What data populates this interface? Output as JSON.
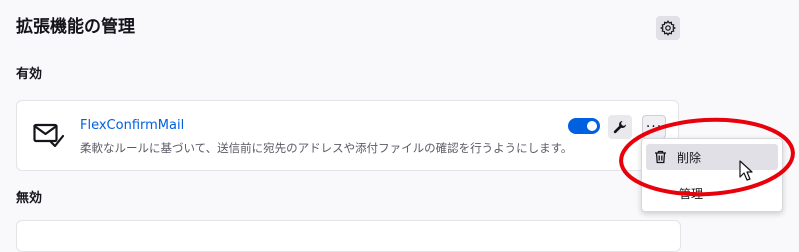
{
  "header": {
    "title": "拡張機能の管理",
    "settings_icon": "gear-icon"
  },
  "sections": {
    "enabled_heading": "有効",
    "disabled_heading": "無効"
  },
  "addon": {
    "name": "FlexConfirmMail",
    "description": "柔軟なルールに基づいて、送信前に宛先のアドレスや添付ファイルの確認を行うようにします。",
    "icon": "mail-check-icon",
    "enabled": true
  },
  "menu": {
    "items": [
      {
        "label": "削除",
        "icon": "trash-icon"
      },
      {
        "label": "管理"
      }
    ]
  },
  "colors": {
    "accent": "#0061e0",
    "annotation": "#e8000b"
  }
}
